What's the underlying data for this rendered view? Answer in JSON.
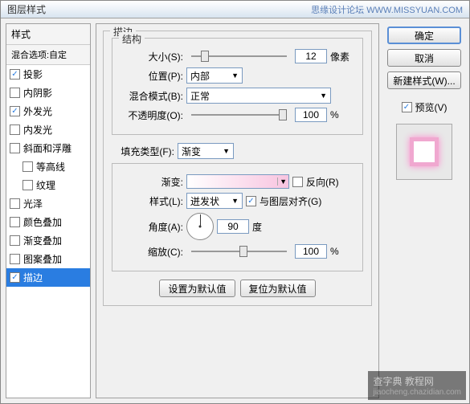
{
  "dialog": {
    "title": "图层样式",
    "watermark": "思缘设计论坛  WWW.MISSYUAN.COM"
  },
  "left": {
    "header": "样式",
    "subheader": "混合选项:自定",
    "items": [
      {
        "label": "投影",
        "checked": true,
        "indent": false
      },
      {
        "label": "内阴影",
        "checked": false,
        "indent": false
      },
      {
        "label": "外发光",
        "checked": true,
        "indent": false
      },
      {
        "label": "内发光",
        "checked": false,
        "indent": false
      },
      {
        "label": "斜面和浮雕",
        "checked": false,
        "indent": false
      },
      {
        "label": "等高线",
        "checked": false,
        "indent": true
      },
      {
        "label": "纹理",
        "checked": false,
        "indent": true
      },
      {
        "label": "光泽",
        "checked": false,
        "indent": false
      },
      {
        "label": "颜色叠加",
        "checked": false,
        "indent": false
      },
      {
        "label": "渐变叠加",
        "checked": false,
        "indent": false
      },
      {
        "label": "图案叠加",
        "checked": false,
        "indent": false
      },
      {
        "label": "描边",
        "checked": true,
        "indent": false,
        "selected": true
      }
    ]
  },
  "center": {
    "title": "描边",
    "structure": {
      "legend": "结构",
      "size_label": "大小(S):",
      "size_value": "12",
      "size_unit": "像素",
      "size_thumb_pct": 10,
      "position_label": "位置(P):",
      "position_value": "内部",
      "blend_label": "混合模式(B):",
      "blend_value": "正常",
      "opacity_label": "不透明度(O):",
      "opacity_value": "100",
      "opacity_unit": "%",
      "opacity_thumb_pct": 100
    },
    "fill": {
      "legend_label": "填充类型(F):",
      "legend_value": "渐变",
      "gradient_label": "渐变:",
      "reverse_label": "反向(R)",
      "reverse_checked": false,
      "style_label": "样式(L):",
      "style_value": "迸发状",
      "align_label": "与图层对齐(G)",
      "align_checked": true,
      "angle_label": "角度(A):",
      "angle_value": "90",
      "angle_unit": "度",
      "scale_label": "缩放(C):",
      "scale_value": "100",
      "scale_unit": "%",
      "scale_thumb_pct": 50
    },
    "buttons": {
      "set_default": "设置为默认值",
      "reset_default": "复位为默认值"
    }
  },
  "right": {
    "ok": "确定",
    "cancel": "取消",
    "new_style": "新建样式(W)...",
    "preview_label": "预览(V)",
    "preview_checked": true
  },
  "footer": {
    "line1": "查字典 教程网",
    "line2": "jiaocheng.chazidian.com"
  }
}
